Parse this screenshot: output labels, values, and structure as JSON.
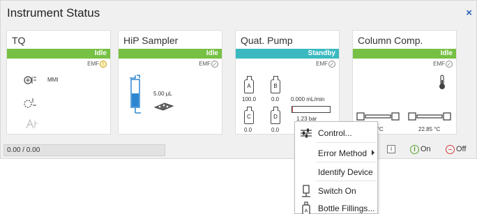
{
  "window": {
    "title": "Instrument Status",
    "close_glyph": "×"
  },
  "modules": {
    "tq": {
      "name": "TQ",
      "status": "Idle",
      "emf_label": "EMF",
      "emf_badge": "!",
      "source_label": "MMI"
    },
    "sampler": {
      "name": "HiP Sampler",
      "status": "Idle",
      "emf_label": "EMF",
      "emf_badge": "✓",
      "volume": "5.00 µL"
    },
    "pump": {
      "name": "Quat. Pump",
      "status": "Standby",
      "emf_label": "EMF",
      "emf_badge": "✓",
      "bottles": [
        {
          "letter": "A",
          "value": "100.0"
        },
        {
          "letter": "B",
          "value": "0.0"
        },
        {
          "letter": "C",
          "value": "0.0"
        },
        {
          "letter": "D",
          "value": "0.0"
        }
      ],
      "flow": "0.000 mL/min",
      "pressure": "1.23 bar",
      "pressure_fill_pct": 2
    },
    "column": {
      "name": "Column Comp.",
      "status": "Idle",
      "emf_label": "EMF",
      "emf_badge": "✓",
      "temp_left": "0 °C",
      "temp_right": "22.85 °C"
    }
  },
  "status_bar": {
    "counter": "0.00 / 0.00",
    "info_glyph": "i",
    "on_label": "On",
    "off_label": "Off",
    "on_glyph": "I",
    "off_glyph": "–"
  },
  "context_menu": {
    "items": [
      {
        "label": "Control...",
        "icon": "sliders-icon"
      },
      {
        "label": "Error Method",
        "icon": "",
        "submenu": true
      },
      {
        "label": "Identify Device",
        "icon": ""
      },
      {
        "label": "Switch On",
        "icon": "switch-on-icon"
      },
      {
        "label": "Bottle Fillings...",
        "icon": "bottle-icon"
      }
    ]
  },
  "colors": {
    "idle": "#76c043",
    "standby": "#3ab9c0",
    "accent": "#2a62b6"
  }
}
